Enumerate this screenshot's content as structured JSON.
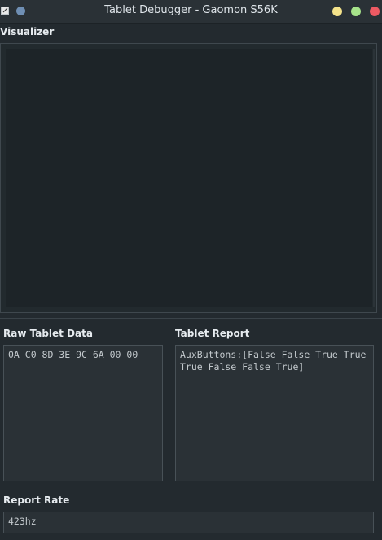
{
  "window": {
    "title": "Tablet Debugger - Gaomon S56K"
  },
  "colors": {
    "background": "#232a2f",
    "titlebar": "#2a3136",
    "minimize_button": "#f3e28a",
    "maximize_button": "#a6e38a",
    "close_button": "#ed5a63",
    "pin_button": "#6f8fb4"
  },
  "visualizer": {
    "label": "Visualizer"
  },
  "raw_data": {
    "label": "Raw Tablet Data",
    "value": "0A C0 8D 3E 9C 6A 00 00"
  },
  "tablet_report": {
    "label": "Tablet Report",
    "value": "AuxButtons:[False False True True True False False True]"
  },
  "report_rate": {
    "label": "Report Rate",
    "value": "423hz"
  }
}
